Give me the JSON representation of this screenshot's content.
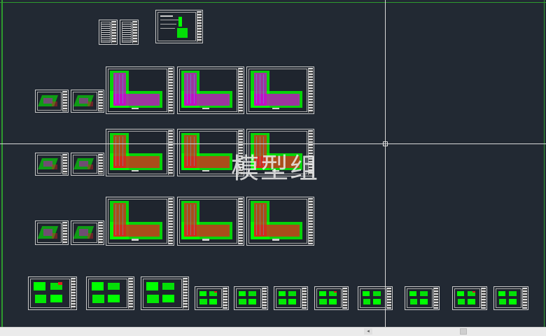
{
  "watermark": {
    "text": "模型组"
  },
  "colors": {
    "background": "#222933",
    "frame": "#2e9a2e",
    "linework": "#00ff00",
    "accent_magenta": "#d000d0",
    "accent_red": "#e02020",
    "crosshair": "#d8d8d8"
  },
  "statusbar": {
    "scroll_left_icon": "◂"
  }
}
